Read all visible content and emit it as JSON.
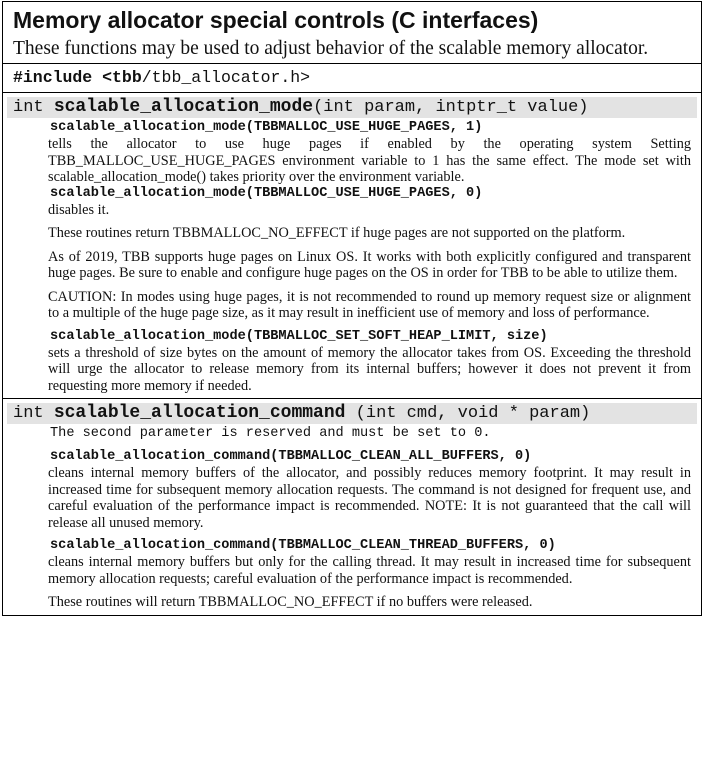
{
  "title": "Memory allocator special controls (C interfaces)",
  "intro": "These functions may be used to adjust behavior of the scalable memory allocator.",
  "include": {
    "directive": "#include",
    "lt": "<",
    "tbb": "tbb",
    "path": "/tbb_allocator.h>"
  },
  "mode_section": {
    "sig_prefix": "int ",
    "sig_name": "scalable_allocation_mode",
    "sig_args": "(int param, intptr_t value)",
    "call1": "scalable_allocation_mode(TBBMALLOC_USE_HUGE_PAGES, 1)",
    "call1_desc": "tells the allocator to use huge pages if enabled by the operating system Setting TBB_MALLOC_USE_HUGE_PAGES environment variable to 1 has the same effect. The mode set with scalable_allocation_mode() takes priority over the environment variable.",
    "call2": "scalable_allocation_mode(TBBMALLOC_USE_HUGE_PAGES, 0)",
    "call2_desc": "disables it.",
    "p_return": "These routines return TBBMALLOC_NO_EFFECT if huge pages are not supported on the platform.",
    "p_2019": "As of 2019, TBB supports huge pages on Linux OS. It works with both explicitly configured and transparent huge pages. Be sure to enable and configure huge pages on the OS in order for TBB to be able to utilize them.",
    "p_caution": "CAUTION: In modes using huge pages, it is not recommended to round up memory request size or alignment to a multiple of the huge page size, as it may result in inefficient use of memory and loss of performance.",
    "call3": "scalable_allocation_mode(TBBMALLOC_SET_SOFT_HEAP_LIMIT, size)",
    "call3_desc": "sets a threshold of size bytes on the amount of memory the allocator takes from OS. Exceeding the threshold will urge the allocator to release memory from its internal buffers; however it does not prevent it from requesting more memory if needed."
  },
  "command_section": {
    "sig_prefix": "int ",
    "sig_name": "scalable_allocation_command",
    "sig_args": " (int cmd, void * param)",
    "note": "The second parameter is reserved and must be set to 0.",
    "call1": "scalable_allocation_command(TBBMALLOC_CLEAN_ALL_BUFFERS, 0)",
    "call1_desc": "cleans internal memory buffers of the allocator, and possibly reduces memory footprint. It may result in increased time for subsequent memory allocation requests. The command is not designed for frequent use, and careful evaluation of the performance impact is recommended. NOTE: It is not guaranteed that the call will release all unused memory.",
    "call2": "scalable_allocation_command(TBBMALLOC_CLEAN_THREAD_BUFFERS, 0)",
    "call2_desc": "cleans internal memory buffers but only for the calling thread. It may result in increased time for subsequent memory allocation requests; careful evaluation of the performance impact is recommended.",
    "p_return": "These routines will return TBBMALLOC_NO_EFFECT if no buffers were released."
  }
}
